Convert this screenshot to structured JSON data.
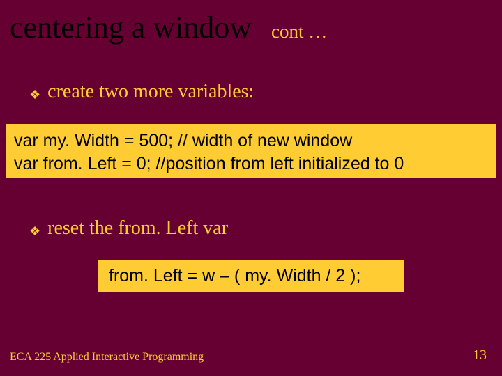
{
  "title": "centering a window",
  "subtitle": "cont …",
  "bullets": {
    "b1": "create two more variables:",
    "b2": "reset the from. Left var"
  },
  "code": {
    "line1": "var my. Width = 500;  // width of new window",
    "line2": "var from. Left = 0;  //position from left initialized to 0",
    "line3": "from. Left = w – ( my. Width / 2 );"
  },
  "footer": {
    "course": "ECA 225   Applied Interactive Programming",
    "page": "13"
  },
  "glyphs": {
    "diamond": "❖"
  }
}
